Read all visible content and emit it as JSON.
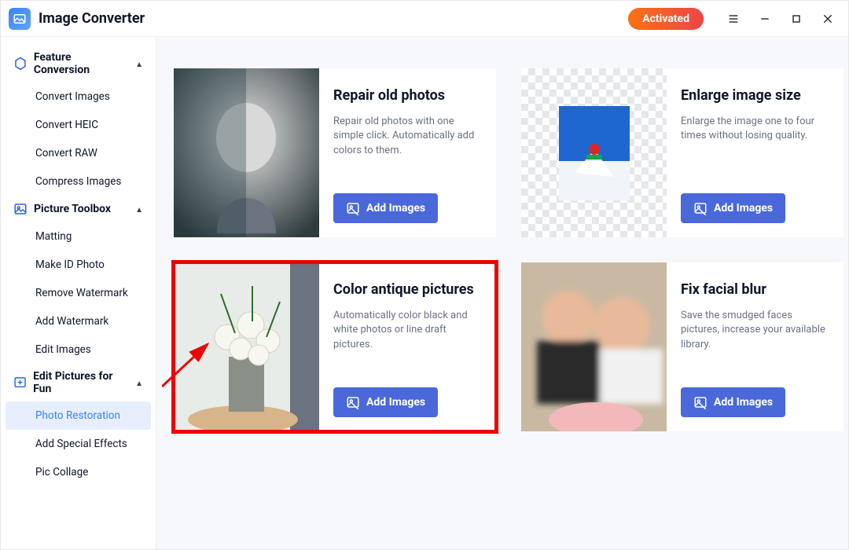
{
  "app_title": "Image Converter",
  "status_pill": "Activated",
  "sidebar": {
    "sections": [
      {
        "label": "Feature Conversion",
        "expanded": true,
        "items": [
          "Convert Images",
          "Convert HEIC",
          "Convert RAW",
          "Compress Images"
        ]
      },
      {
        "label": "Picture Toolbox",
        "expanded": true,
        "items": [
          "Matting",
          "Make ID Photo",
          "Remove Watermark",
          "Add Watermark",
          "Edit Images"
        ]
      },
      {
        "label": "Edit Pictures for Fun",
        "expanded": true,
        "items": [
          "Photo Restoration",
          "Add Special Effects",
          "Pic Collage"
        ],
        "active_index": 0
      }
    ]
  },
  "cards": [
    {
      "title": "Repair old photos",
      "desc": "Repair old photos with one simple click. Automatically add colors to them.",
      "button": "Add Images"
    },
    {
      "title": "Enlarge image size",
      "desc": "Enlarge the image one to four times without losing quality.",
      "button": "Add Images"
    },
    {
      "title": "Color antique pictures",
      "desc": "Automatically color black and white photos or line draft pictures.",
      "button": "Add Images"
    },
    {
      "title": "Fix facial blur",
      "desc": "Save the smudged faces pictures, increase your available library.",
      "button": "Add Images"
    }
  ]
}
